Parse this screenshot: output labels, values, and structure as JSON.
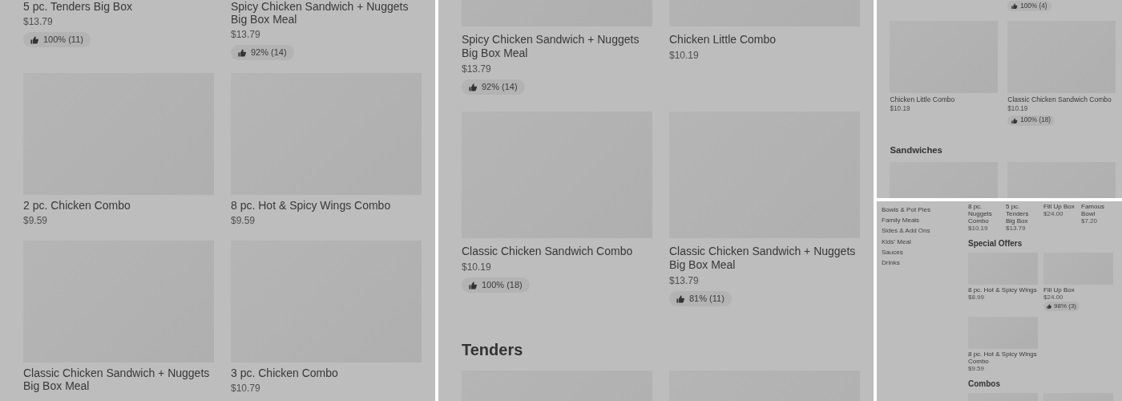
{
  "panels": [
    {
      "sections": [
        {
          "kind": "grid",
          "items": [
            {
              "kind": "card",
              "name": "5 pc. Tenders Big Box",
              "price": "$13.79",
              "rating": "100% (11)",
              "photo": false
            },
            {
              "kind": "card",
              "name": "Spicy Chicken Sandwich + Nuggets Big Box Meal",
              "price": "$13.79",
              "rating": "92% (14)",
              "photo": false
            },
            {
              "kind": "card",
              "name": "2 pc. Chicken Combo",
              "price": "$9.59",
              "photo": true
            },
            {
              "kind": "card",
              "name": "8 pc. Hot & Spicy Wings Combo",
              "price": "$9.59",
              "photo": true
            },
            {
              "kind": "card",
              "name": "Classic Chicken Sandwich + Nuggets Big Box Meal",
              "photo": true
            },
            {
              "kind": "card",
              "name": "3 pc. Chicken Combo",
              "price": "$10.79",
              "photo": true
            }
          ]
        }
      ]
    },
    {
      "sections": [
        {
          "kind": "grid",
          "items": [
            {
              "kind": "card",
              "name": "Spicy Chicken Sandwich + Nuggets Big Box Meal",
              "price": "$13.79",
              "rating": "92% (14)",
              "photo": true
            },
            {
              "kind": "card",
              "name": "Chicken Little Combo",
              "price": "$10.19",
              "photo": true
            },
            {
              "kind": "card",
              "name": "Classic Chicken Sandwich Combo",
              "price": "$10.19",
              "rating": "100% (18)",
              "photo": true
            },
            {
              "kind": "card",
              "name": "Classic Chicken Sandwich + Nuggets Big Box Meal",
              "price": "$13.79",
              "rating": "81% (11)",
              "photo": true
            }
          ]
        },
        {
          "kind": "heading",
          "text": "Tenders"
        },
        {
          "kind": "grid",
          "items": [
            {
              "kind": "card",
              "photo": true
            },
            {
              "kind": "card",
              "photo": true
            }
          ]
        }
      ]
    },
    {
      "sections": [
        {
          "kind": "grid",
          "items": [
            {
              "kind": "spacer"
            },
            {
              "kind": "card",
              "rating": "100% (4)",
              "photo": false
            },
            {
              "kind": "card",
              "name": "Chicken Little Combo",
              "price": "$10.19",
              "photo": true
            },
            {
              "kind": "card",
              "name": "Classic Chicken Sandwich Combo",
              "price": "$10.19",
              "rating": "100% (18)",
              "photo": true
            }
          ]
        },
        {
          "kind": "heading",
          "text": "Sandwiches"
        },
        {
          "kind": "grid",
          "items": [
            {
              "kind": "card",
              "photo": true
            },
            {
              "kind": "card",
              "photo": true
            }
          ]
        }
      ]
    },
    {
      "sidebar": [
        {
          "label": "Bowls & Pot Pies"
        },
        {
          "label": "Family Meals"
        },
        {
          "label": "Sides & Add Ons"
        },
        {
          "label": "Kids' Meal"
        },
        {
          "label": "Sauces"
        },
        {
          "label": "Drinks"
        }
      ],
      "sections": [
        {
          "kind": "compact-grid",
          "items": [
            {
              "kind": "card",
              "name": "8 pc. Nuggets Combo",
              "price": "$10.19",
              "photo": false
            },
            {
              "kind": "card",
              "name": "5 pc. Tenders Big Box",
              "price": "$13.79",
              "photo": false
            },
            {
              "kind": "card",
              "name": "Fill Up Box",
              "price": "$24.00",
              "photo": false
            },
            {
              "kind": "card",
              "name": "Famous Bowl",
              "price": "$7.20",
              "photo": false
            }
          ]
        },
        {
          "kind": "heading",
          "text": "Special Offers"
        },
        {
          "kind": "grid",
          "items": [
            {
              "kind": "card",
              "name": "8 pc. Hot & Spicy Wings",
              "price": "$8.99",
              "photo": true
            },
            {
              "kind": "card",
              "name": "Fill Up Box",
              "price": "$24.00",
              "rating": "98% (3)",
              "photo": true
            },
            {
              "kind": "card",
              "name": "8 pc. Hot & Spicy Wings Combo",
              "price": "$9.59",
              "photo": true
            }
          ]
        },
        {
          "kind": "heading",
          "text": "Combos"
        },
        {
          "kind": "grid",
          "items": [
            {
              "kind": "card",
              "photo": true
            },
            {
              "kind": "card",
              "photo": true
            }
          ]
        }
      ]
    }
  ]
}
